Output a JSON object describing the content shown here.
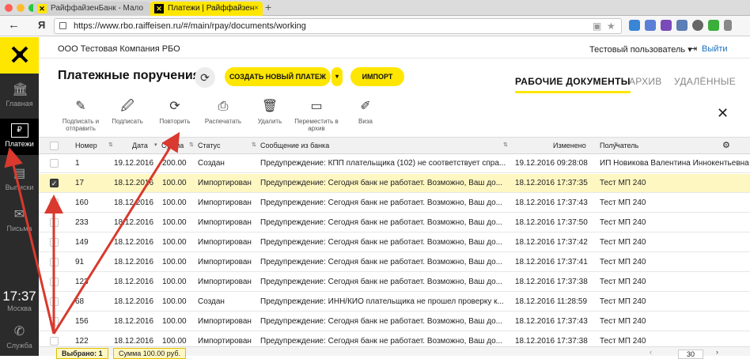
{
  "browser": {
    "tabs": [
      {
        "label": "РайффайзенБанк - Мало",
        "close": "×"
      },
      {
        "label": "Платежи | Райффайзен",
        "close": "×"
      }
    ],
    "new_tab": "+",
    "back": "←",
    "ya": "Я",
    "url": "https://www.rbo.raiffeisen.ru/#/main/rpay/documents/working",
    "favicon": "Я"
  },
  "header": {
    "company": "ООО Тестовая Компания РБО",
    "user": "Тестовый пользователь ▾",
    "logout": "Выйти"
  },
  "sidebar": {
    "logo": "✕",
    "items": [
      {
        "label": "Главная",
        "icon": "bank-icon"
      },
      {
        "label": "Платежи",
        "icon": "ruble-icon"
      },
      {
        "label": "Выписки",
        "icon": "statement-icon"
      },
      {
        "label": "Письма",
        "icon": "mail-icon"
      }
    ],
    "time": "17:37",
    "city": "Москва",
    "support": "Служба"
  },
  "page": {
    "title": "Платежные поручения",
    "create_btn": "СОЗДАТЬ НОВЫЙ ПЛАТЕЖ",
    "import_btn": "ИМПОРТ",
    "tabs": [
      "РАБОЧИЕ ДОКУМЕНТЫ",
      "АРХИВ",
      "УДАЛЁННЫЕ"
    ]
  },
  "actions": [
    {
      "label": "Подписать и отправить",
      "icon": "sign-send-icon"
    },
    {
      "label": "Подписать",
      "icon": "sign-icon"
    },
    {
      "label": "Повторить",
      "icon": "repeat-icon"
    },
    {
      "label": "Распечатать",
      "icon": "print-icon"
    },
    {
      "label": "Удалить",
      "icon": "trash-icon"
    },
    {
      "label": "Переместить в архив",
      "icon": "archive-icon"
    },
    {
      "label": "Виза",
      "icon": "pen-icon"
    }
  ],
  "table": {
    "columns": [
      "Номер",
      "Дата",
      "Сумма",
      "Статус",
      "Сообщение из банка",
      "Изменено",
      "Получатель"
    ],
    "rows": [
      {
        "num": "1",
        "date": "19.12.2016",
        "sum": "200.00",
        "status": "Создан",
        "msg": "Предупреждение: КПП плательщика (102) не соответствует спра...",
        "changed": "19.12.2016 09:28:08",
        "recipient": "ИП Новикова Валентина Иннокентьевна",
        "checked": false
      },
      {
        "num": "17",
        "date": "18.12.2016",
        "sum": "100.00",
        "status": "Импортирован",
        "msg": "Предупреждение: Сегодня банк не работает. Возможно, Ваш до...",
        "changed": "18.12.2016 17:37:35",
        "recipient": "Тест МП 240",
        "checked": true
      },
      {
        "num": "160",
        "date": "18.12.2016",
        "sum": "100.00",
        "status": "Импортирован",
        "msg": "Предупреждение: Сегодня банк не работает. Возможно, Ваш до...",
        "changed": "18.12.2016 17:37:43",
        "recipient": "Тест МП 240",
        "checked": false
      },
      {
        "num": "233",
        "date": "18.12.2016",
        "sum": "100.00",
        "status": "Импортирован",
        "msg": "Предупреждение: Сегодня банк не работает. Возможно, Ваш до...",
        "changed": "18.12.2016 17:37:50",
        "recipient": "Тест МП 240",
        "checked": false
      },
      {
        "num": "149",
        "date": "18.12.2016",
        "sum": "100.00",
        "status": "Импортирован",
        "msg": "Предупреждение: Сегодня банк не работает. Возможно, Ваш до...",
        "changed": "18.12.2016 17:37:42",
        "recipient": "Тест МП 240",
        "checked": false
      },
      {
        "num": "91",
        "date": "18.12.2016",
        "sum": "100.00",
        "status": "Импортирован",
        "msg": "Предупреждение: Сегодня банк не работает. Возможно, Ваш до...",
        "changed": "18.12.2016 17:37:41",
        "recipient": "Тест МП 240",
        "checked": false
      },
      {
        "num": "123",
        "date": "18.12.2016",
        "sum": "100.00",
        "status": "Импортирован",
        "msg": "Предупреждение: Сегодня банк не работает. Возможно, Ваш до...",
        "changed": "18.12.2016 17:37:38",
        "recipient": "Тест МП 240",
        "checked": false
      },
      {
        "num": "68",
        "date": "18.12.2016",
        "sum": "100.00",
        "status": "Создан",
        "msg": "Предупреждение: ИНН/КИО плательщика не прошел проверку к...",
        "changed": "18.12.2016 11:28:59",
        "recipient": "Тест МП 240",
        "checked": false
      },
      {
        "num": "156",
        "date": "18.12.2016",
        "sum": "100.00",
        "status": "Импортирован",
        "msg": "Предупреждение: Сегодня банк не работает. Возможно, Ваш до...",
        "changed": "18.12.2016 17:37:43",
        "recipient": "Тест МП 240",
        "checked": false
      },
      {
        "num": "122",
        "date": "18.12.2016",
        "sum": "100.00",
        "status": "Импортирован",
        "msg": "Предупреждение: Сегодня банк не работает. Возможно, Ваш до...",
        "changed": "18.12.2016 17:37:38",
        "recipient": "Тест МП 240",
        "checked": false
      }
    ]
  },
  "footer": {
    "selected": "Выбрано: 1",
    "sum": "Сумма 100.00 руб.",
    "page_size": "30",
    "next": "›"
  },
  "colors": {
    "brand": "#fee600",
    "sidebar": "#2b2b2b",
    "selected_row": "#fff7c2",
    "annotation_arrow": "#d9392e"
  }
}
